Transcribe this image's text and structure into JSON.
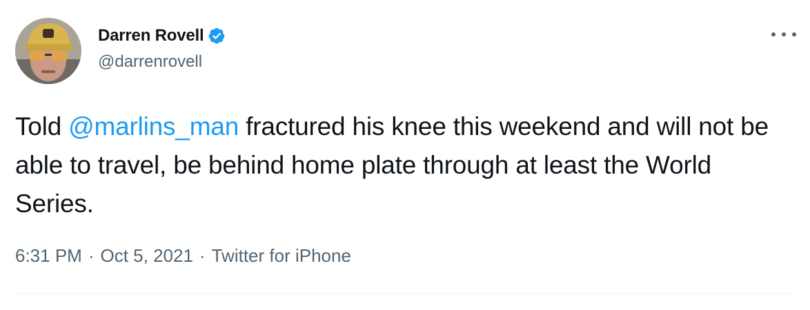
{
  "author": {
    "display_name": "Darren Rovell",
    "handle": "@darrenrovell",
    "verified": true
  },
  "tweet": {
    "text_before": "Told ",
    "mention": "@marlins_man",
    "text_after": " fractured his knee this weekend and will not be able to travel, be behind home plate through at least the World Series."
  },
  "meta": {
    "time": "6:31 PM",
    "separator": "·",
    "date": "Oct 5, 2021",
    "source": "Twitter for iPhone"
  },
  "colors": {
    "text": "#0f1419",
    "secondary": "#536471",
    "link": "#1d9bf0",
    "verified": "#1d9bf0"
  },
  "icons": {
    "verified": "verified-badge-icon",
    "more": "more-options-icon"
  }
}
